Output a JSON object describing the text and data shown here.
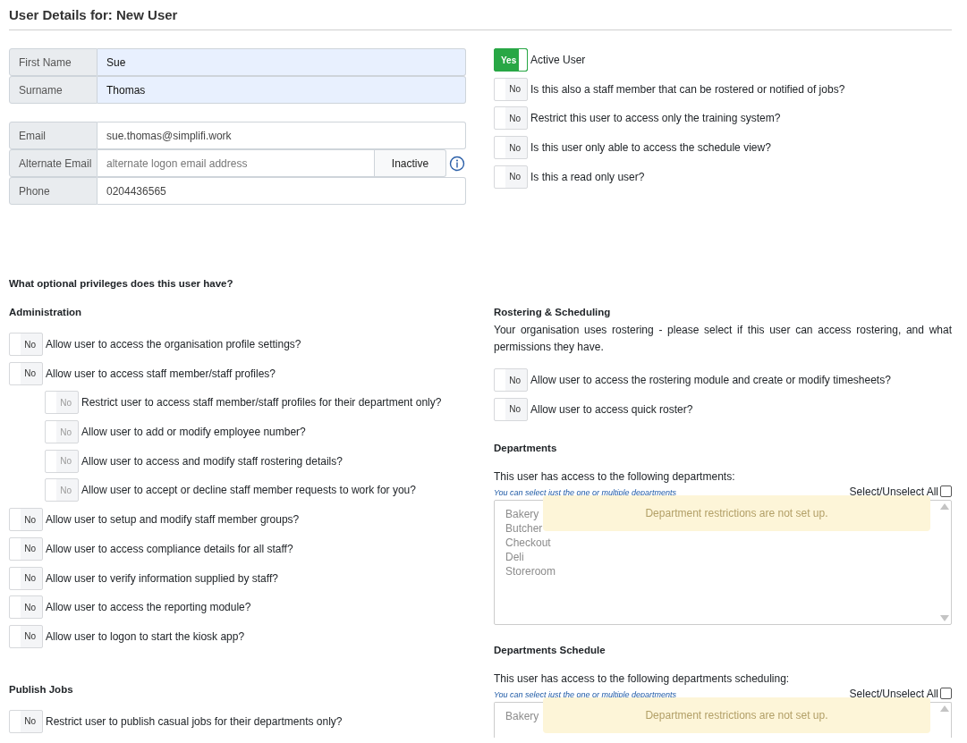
{
  "title": "User Details for: New User",
  "name_fields": [
    {
      "label": "First Name",
      "value": "Sue",
      "highlighted": true
    },
    {
      "label": "Surname",
      "value": "Thomas",
      "highlighted": true
    }
  ],
  "contact_fields": [
    {
      "label": "Email",
      "value": "sue.thomas@simplifi.work",
      "highlighted": false
    },
    {
      "label": "Alternate Email",
      "placeholder": "alternate logon email address",
      "button": "Inactive",
      "info": true,
      "highlighted": false
    },
    {
      "label": "Phone",
      "value": "0204436565",
      "highlighted": false
    }
  ],
  "user_flags": [
    {
      "state_label": "Yes",
      "on": true,
      "text": "Active User"
    },
    {
      "state_label": "No",
      "on": false,
      "text": "Is this also a staff member that can be rostered or notified of jobs?"
    },
    {
      "state_label": "No",
      "on": false,
      "text": "Restrict this user to access only the training system?"
    },
    {
      "state_label": "No",
      "on": false,
      "text": "Is this user only able to access the schedule view?"
    },
    {
      "state_label": "No",
      "on": false,
      "text": "Is this a read only user?"
    }
  ],
  "privileges_heading": "What optional privileges does this user have?",
  "administration": {
    "heading": "Administration",
    "items": [
      {
        "state_label": "No",
        "on": false,
        "disabled": false,
        "text": "Allow user to access the organisation profile settings?"
      },
      {
        "state_label": "No",
        "on": false,
        "disabled": false,
        "text": "Allow user to access staff member/staff profiles?",
        "children": [
          {
            "state_label": "No",
            "on": false,
            "disabled": true,
            "text": "Restrict user to access staff member/staff profiles for their department only?"
          },
          {
            "state_label": "No",
            "on": false,
            "disabled": true,
            "text": "Allow user to add or modify employee number?"
          },
          {
            "state_label": "No",
            "on": false,
            "disabled": true,
            "text": "Allow user to access and modify staff rostering details?"
          },
          {
            "state_label": "No",
            "on": false,
            "disabled": true,
            "text": "Allow user to accept or decline staff member requests to work for you?"
          }
        ]
      },
      {
        "state_label": "No",
        "on": false,
        "disabled": false,
        "text": "Allow user to setup and modify staff member groups?"
      },
      {
        "state_label": "No",
        "on": false,
        "disabled": false,
        "text": "Allow user to access compliance details for all staff?"
      },
      {
        "state_label": "No",
        "on": false,
        "disabled": false,
        "text": "Allow user to verify information supplied by staff?"
      },
      {
        "state_label": "No",
        "on": false,
        "disabled": false,
        "text": "Allow user to access the reporting module?"
      },
      {
        "state_label": "No",
        "on": false,
        "disabled": false,
        "text": "Allow user to logon to start the kiosk app?"
      }
    ]
  },
  "publish_jobs": {
    "heading": "Publish Jobs",
    "items": [
      {
        "state_label": "No",
        "on": false,
        "disabled": false,
        "text": "Restrict user to publish casual jobs for their departments only?"
      }
    ]
  },
  "rostering": {
    "heading": "Rostering & Scheduling",
    "description": "Your organisation uses rostering - please select if this user can access rostering, and what permissions they have.",
    "items": [
      {
        "state_label": "No",
        "on": false,
        "disabled": false,
        "text": "Allow user to access the rostering module and create or modify timesheets?"
      },
      {
        "state_label": "No",
        "on": false,
        "disabled": false,
        "text": "Allow user to access quick roster?"
      }
    ]
  },
  "department_sections": [
    {
      "heading": "Departments",
      "intro": "This user has access to the following departments:",
      "hint": "You can select just the one or multiple departments",
      "select_all": "Select/Unselect All",
      "checked": false,
      "disabled": true,
      "cut_off": false,
      "items": [
        "Bakery",
        "Butcher",
        "Checkout",
        "Deli",
        "Storeroom"
      ],
      "notice": "Department restrictions are not set up."
    },
    {
      "heading": "Departments Schedule",
      "intro": "This user has access to the following departments scheduling:",
      "hint": "You can select just the one or multiple departments",
      "select_all": "Select/Unselect All",
      "checked": false,
      "disabled": true,
      "cut_off": true,
      "items": [
        "Bakery"
      ],
      "notice": "Department restrictions are not set up."
    }
  ]
}
